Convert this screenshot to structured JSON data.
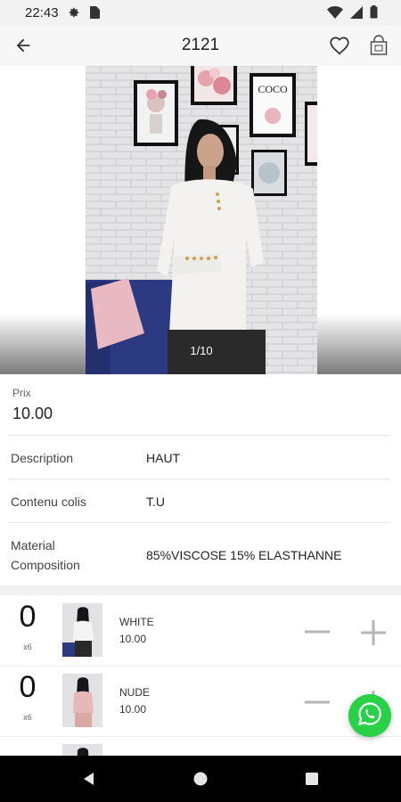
{
  "status_bar": {
    "time": "22:43",
    "icons": [
      "gear-icon",
      "sim-card-icon",
      "wifi-icon",
      "signal-icon",
      "battery-icon"
    ]
  },
  "app_bar": {
    "title": "2121",
    "icons": [
      "back-arrow-icon",
      "heart-icon",
      "shopping-bag-icon"
    ]
  },
  "gallery": {
    "counter": "1/10",
    "artwork_text": "COCO"
  },
  "price": {
    "label": "Prix",
    "value": "10.00"
  },
  "details": [
    {
      "key": "Description",
      "value": "HAUT"
    },
    {
      "key": "Contenu colis",
      "value": "T.U"
    },
    {
      "key_line1": "Material",
      "key_line2": "Composition",
      "value": "85%VISCOSE 15% ELASTHANNE"
    }
  ],
  "variants": [
    {
      "qty": "0",
      "qty_label": "x6",
      "name": "WHITE",
      "price": "10.00"
    },
    {
      "qty": "0",
      "qty_label": "x6",
      "name": "NUDE",
      "price": "10.00"
    }
  ],
  "colors": {
    "whatsapp": "#28d146",
    "app_bar_bg": "#f7f7f7",
    "nav_bar_bg": "#000000"
  }
}
